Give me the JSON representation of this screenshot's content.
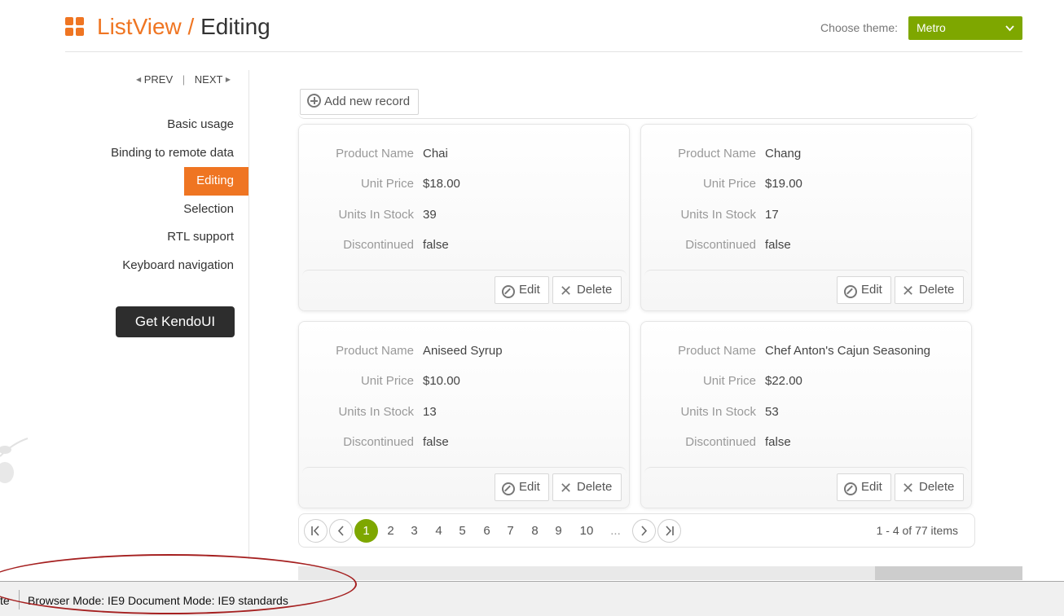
{
  "header": {
    "component": "ListView",
    "separator": "/",
    "page": "Editing",
    "theme_label": "Choose theme:",
    "theme_value": "Metro",
    "accent_color": "#ef7522",
    "theme_color": "#7ea700"
  },
  "sidebar": {
    "prev": "PREV",
    "divider": "|",
    "next": "NEXT",
    "items": [
      {
        "label": "Basic usage"
      },
      {
        "label": "Binding to remote data"
      },
      {
        "label": "Editing"
      },
      {
        "label": "Selection"
      },
      {
        "label": "RTL support"
      },
      {
        "label": "Keyboard navigation"
      }
    ],
    "active_item": "Editing",
    "cta": "Get KendoUI"
  },
  "toolbar": {
    "add_label": "Add new record"
  },
  "labels": {
    "product_name": "Product Name",
    "unit_price": "Unit Price",
    "units_in_stock": "Units In Stock",
    "discontinued": "Discontinued",
    "edit": "Edit",
    "delete": "Delete"
  },
  "products": [
    {
      "name": "Chai",
      "price": "$18.00",
      "stock": "39",
      "discontinued": "false"
    },
    {
      "name": "Chang",
      "price": "$19.00",
      "stock": "17",
      "discontinued": "false"
    },
    {
      "name": "Aniseed Syrup",
      "price": "$10.00",
      "stock": "13",
      "discontinued": "false"
    },
    {
      "name": "Chef Anton's Cajun Seasoning",
      "price": "$22.00",
      "stock": "53",
      "discontinued": "false"
    }
  ],
  "pager": {
    "pages": [
      "1",
      "2",
      "3",
      "4",
      "5",
      "6",
      "7",
      "8",
      "9",
      "10",
      "..."
    ],
    "current": "1",
    "info": "1 - 4 of 77 items"
  },
  "statusbar": {
    "left_fragment": "te",
    "text": "Browser Mode:  IE9   Document Mode:  IE9 standards"
  }
}
